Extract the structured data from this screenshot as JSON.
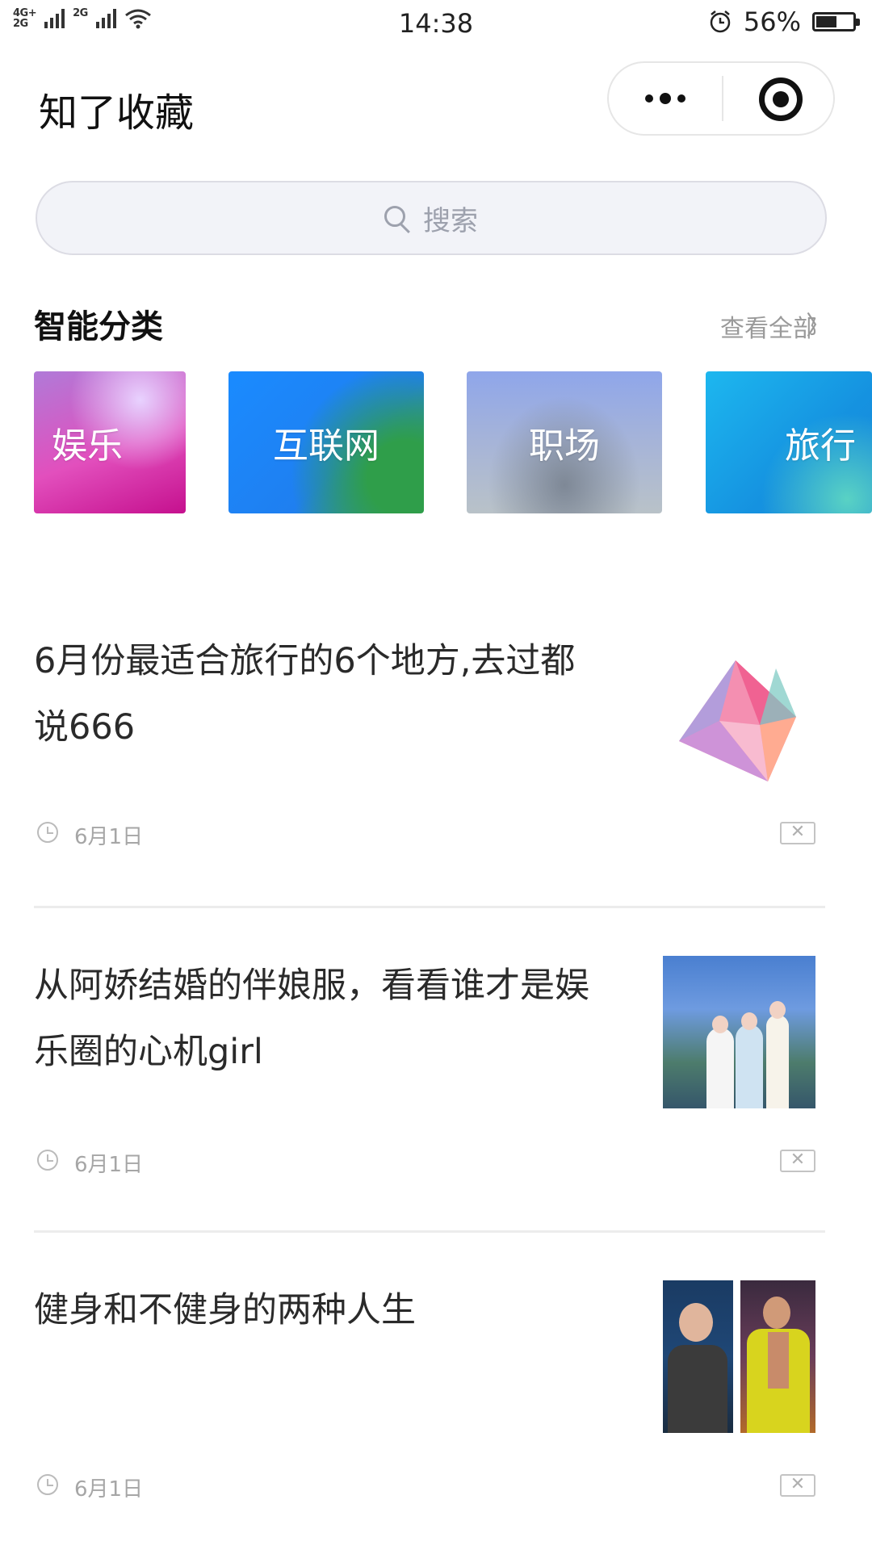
{
  "status_bar": {
    "network_top": "4G+",
    "network_bottom": "2G",
    "network2": "2G",
    "time": "14:38",
    "battery_percent_text": "56%",
    "battery_level": 0.56
  },
  "nav": {
    "title": "知了收藏"
  },
  "search": {
    "placeholder": "搜索"
  },
  "section": {
    "title": "智能分类",
    "more": "查看全部",
    "chevron": "〉"
  },
  "categories": [
    {
      "label": "娱乐"
    },
    {
      "label": "互联网"
    },
    {
      "label": "职场"
    },
    {
      "label": "旅行"
    }
  ],
  "articles": [
    {
      "title": "6月份最适合旅行的6个地方,去过都说666",
      "date": "6月1日",
      "thumb": "gem-logo"
    },
    {
      "title": "从阿娇结婚的伴娘服，看看谁才是娱乐圈的心机girl",
      "date": "6月1日",
      "thumb": "wedding-photo"
    },
    {
      "title": "健身和不健身的两种人生",
      "date": "6月1日",
      "thumb": "fitness-photo"
    }
  ],
  "delete_glyph": "✕"
}
